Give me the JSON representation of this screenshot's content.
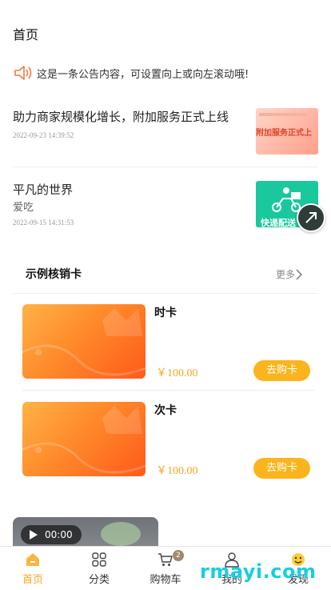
{
  "header": {
    "title": "首页"
  },
  "notice": {
    "text": "这是一条公告内容，可设置向上或向左滚动哦!"
  },
  "news": [
    {
      "title": "助力商家规模化增长，附加服务正式上线",
      "subtitle": "",
      "date": "2022-09-23 14:39:52",
      "thumb_text": "附加服务正式上"
    },
    {
      "title": "平凡的世界",
      "subtitle": "爱吃",
      "date": "2022-09-15 14:31:53",
      "thumb_text": "快递配送"
    }
  ],
  "section": {
    "title": "示例核销卡",
    "more": "更多"
  },
  "cards": [
    {
      "name": "时卡",
      "price": "￥100.00",
      "button": "去购卡"
    },
    {
      "name": "次卡",
      "price": "￥100.00",
      "button": "去购卡"
    }
  ],
  "video": {
    "time": "00:00"
  },
  "tabbar": {
    "items": [
      {
        "label": "首页",
        "icon": "home-icon",
        "active": true
      },
      {
        "label": "分类",
        "icon": "grid-icon"
      },
      {
        "label": "购物车",
        "icon": "cart-icon",
        "badge": "2"
      },
      {
        "label": "我的",
        "icon": "user-icon"
      },
      {
        "label": "发现",
        "icon": "emoji-icon"
      }
    ]
  },
  "watermark": "rmayi.com",
  "colors": {
    "accent": "#f5a623",
    "button": "#fbb41d",
    "speaker": "#f07a3e"
  }
}
